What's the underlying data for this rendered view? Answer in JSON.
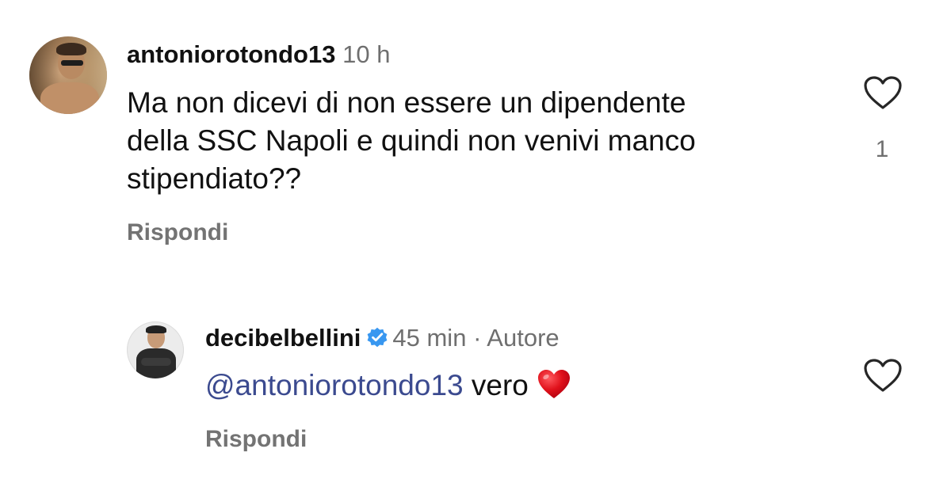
{
  "comments": [
    {
      "username": "antoniorotondo13",
      "time": "10 h",
      "text_lines": [
        "Ma non dicevi di non essere un dipendente",
        "della SSC Napoli e quindi non venivi manco",
        "stipendiato??"
      ],
      "reply_label": "Rispondi",
      "like_count": "1",
      "icon": "heart-outline-icon"
    },
    {
      "username": "decibelbellini",
      "verified": true,
      "time": "45 min",
      "separator": "·",
      "author_label": "Autore",
      "mention": "@antoniorotondo13",
      "text": "vero",
      "reply_label": "Rispondi",
      "icon": "heart-outline-icon"
    }
  ],
  "colors": {
    "text": "#111111",
    "secondary": "#6f6f6f",
    "mention": "#3b4a8f",
    "verified_badge": "#3897f0",
    "heart_emoji": "#e0111b"
  }
}
